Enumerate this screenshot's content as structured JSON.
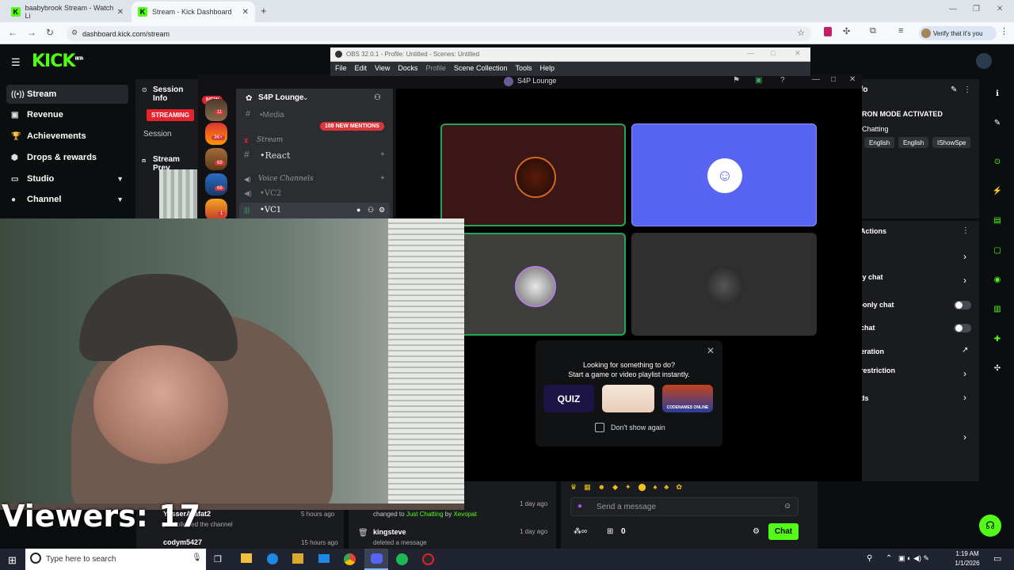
{
  "browser": {
    "tabs": [
      {
        "title": "baabybrook Stream - Watch Li",
        "active": false
      },
      {
        "title": "Stream - Kick Dashboard",
        "active": true
      }
    ],
    "url": "dashboard.kick.com/stream",
    "verify_label": "Verify that it's you"
  },
  "kick": {
    "logo": "KICK",
    "logo_badge": "BETA",
    "nav": [
      {
        "label": "Stream",
        "icon": "stream-icon",
        "active": true
      },
      {
        "label": "Revenue",
        "icon": "dollar-icon"
      },
      {
        "label": "Achievements",
        "icon": "trophy-icon"
      },
      {
        "label": "Drops & rewards",
        "icon": "gift-icon"
      },
      {
        "label": "Studio",
        "icon": "monitor-icon",
        "expandable": true
      },
      {
        "label": "Channel",
        "icon": "user-icon",
        "expandable": true
      }
    ],
    "session_info": "Session Info",
    "streaming_badge": "STREAMING",
    "session_label": "Session",
    "stream_preview": "Stream Prev",
    "right_panel": {
      "title_fragment": "fo",
      "mode": "RON MODE ACTIVATED",
      "category": "Chatting",
      "chips": [
        "English",
        "English",
        "IShowSpe"
      ],
      "actions_title": "Actions",
      "action_rows": [
        "",
        "ly chat",
        "-only chat",
        " chat",
        "eration",
        " restriction",
        "ds",
        ""
      ]
    },
    "activity": [
      {
        "user": "YasserArafat2",
        "action": "just followed the channel",
        "time": "5 hours ago"
      },
      {
        "user": "codym5427",
        "time": "15 hours ago"
      }
    ],
    "mod_log": [
      {
        "text_prefix": "changed to",
        "category": "Just Chatting",
        "by": "by",
        "user": "Xevopat",
        "time": "1 day ago"
      },
      {
        "user": "kingsteve",
        "text": "deleted a message",
        "time": "1 day ago"
      }
    ],
    "chat_placeholder": "Send a message",
    "chat_count": "0",
    "chat_button": "Chat"
  },
  "obs": {
    "title": "OBS 32.0.1 - Profile: Untitled - Scenes: Untitled",
    "menu": [
      "File",
      "Edit",
      "View",
      "Docks",
      "Profile",
      "Scene Collection",
      "Tools",
      "Help"
    ]
  },
  "discord": {
    "server_name": "S4P Lounge",
    "window_title": "S4P Lounge",
    "new_badge": "NEW",
    "mentions_badge": "108 NEW MENTIONS",
    "server_badges": [
      "11",
      "3K+",
      "69",
      "66",
      "1"
    ],
    "channels": [
      {
        "name": "•Media",
        "type": "text"
      },
      {
        "name": "Stream",
        "type": "category-stream"
      },
      {
        "name": "•React",
        "type": "text"
      },
      {
        "name": "Voice Channels",
        "type": "category-voice"
      },
      {
        "name": "•VC2",
        "type": "voice"
      },
      {
        "name": "•VC1",
        "type": "voice-active"
      }
    ],
    "activity_prompt": {
      "line1": "Looking for something to do?",
      "line2": "Start a game or video playlist instantly.",
      "games": [
        "QUIZ",
        "",
        "CODENAMES ONLINE"
      ],
      "checkbox_label": "Don't show again"
    }
  },
  "overlay": {
    "viewers_text": "Viewers: 17"
  },
  "taskbar": {
    "search_placeholder": "Type here to search",
    "time": "1:19 AM",
    "date": "1/1/2026"
  },
  "colors": {
    "kick_green": "#53fc18",
    "streaming_red": "#e5222d",
    "discord_blurple": "#5865f2"
  }
}
